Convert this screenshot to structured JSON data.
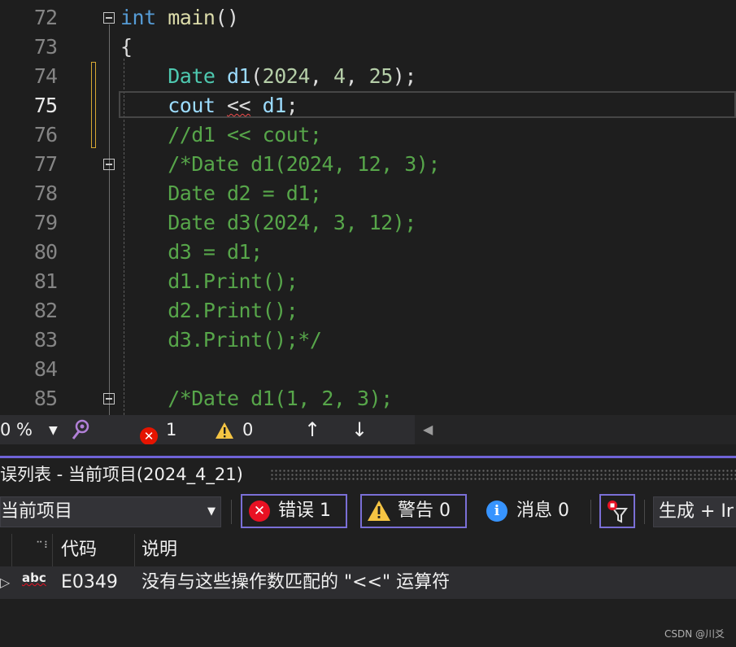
{
  "editor": {
    "lines": [
      {
        "num": "72",
        "parts": [
          {
            "t": "int",
            "c": "kw"
          },
          {
            "t": " ",
            "c": "tx"
          },
          {
            "t": "main",
            "c": "fn"
          },
          {
            "t": "()",
            "c": "tx"
          }
        ],
        "fold": true
      },
      {
        "num": "73",
        "parts": [
          {
            "t": "{",
            "c": "tx"
          }
        ]
      },
      {
        "num": "74",
        "parts": [
          {
            "t": "    ",
            "c": "tx"
          },
          {
            "t": "Date",
            "c": "ty"
          },
          {
            "t": " ",
            "c": "tx"
          },
          {
            "t": "d1",
            "c": "vr"
          },
          {
            "t": "(",
            "c": "tx"
          },
          {
            "t": "2024",
            "c": "num"
          },
          {
            "t": ", ",
            "c": "tx"
          },
          {
            "t": "4",
            "c": "num"
          },
          {
            "t": ", ",
            "c": "tx"
          },
          {
            "t": "25",
            "c": "num"
          },
          {
            "t": ");",
            "c": "tx"
          }
        ]
      },
      {
        "num": "75",
        "active": true,
        "parts": [
          {
            "t": "    ",
            "c": "tx"
          },
          {
            "t": "cout",
            "c": "vr"
          },
          {
            "t": " ",
            "c": "tx"
          },
          {
            "t": "<<",
            "c": "tx",
            "squig": true
          },
          {
            "t": " ",
            "c": "tx"
          },
          {
            "t": "d1",
            "c": "vr"
          },
          {
            "t": ";",
            "c": "tx"
          }
        ]
      },
      {
        "num": "76",
        "parts": [
          {
            "t": "    //d1 << cout;",
            "c": "cm"
          }
        ]
      },
      {
        "num": "77",
        "parts": [
          {
            "t": "    /*Date d1(2024, 12, 3);",
            "c": "cm"
          }
        ],
        "fold": true
      },
      {
        "num": "78",
        "parts": [
          {
            "t": "    Date d2 = d1;",
            "c": "cm"
          }
        ]
      },
      {
        "num": "79",
        "parts": [
          {
            "t": "    Date d3(2024, 3, 12);",
            "c": "cm"
          }
        ]
      },
      {
        "num": "80",
        "parts": [
          {
            "t": "    d3 = d1;",
            "c": "cm"
          }
        ]
      },
      {
        "num": "81",
        "parts": [
          {
            "t": "    d1.Print();",
            "c": "cm"
          }
        ]
      },
      {
        "num": "82",
        "parts": [
          {
            "t": "    d2.Print();",
            "c": "cm"
          }
        ]
      },
      {
        "num": "83",
        "parts": [
          {
            "t": "    d3.Print();*/",
            "c": "cm"
          }
        ]
      },
      {
        "num": "84",
        "parts": []
      },
      {
        "num": "85",
        "parts": [
          {
            "t": "    /*Date d1(1, 2, 3);",
            "c": "cm"
          }
        ],
        "fold": true
      }
    ]
  },
  "status": {
    "zoom": "0 %",
    "error_count": "1",
    "warning_count": "0",
    "up_arrow": "↑",
    "down_arrow": "↓"
  },
  "error_list": {
    "title": "误列表 - 当前项目(2024_4_21)",
    "scope": "当前项目",
    "errors_label": "错误 1",
    "warnings_label": "警告 0",
    "messages_label": "消息 0",
    "build_filter": "生成 + Ir",
    "columns": {
      "code": "代码",
      "description": "说明"
    },
    "rows": [
      {
        "icon": "abc",
        "code": "E0349",
        "description": "没有与这些操作数匹配的 \"<<\" 运算符"
      }
    ]
  },
  "watermark": "CSDN @川爻",
  "colors": {
    "accent": "#6f63d8",
    "error": "#e81123",
    "warning": "#f5c443",
    "info": "#3794ff"
  }
}
